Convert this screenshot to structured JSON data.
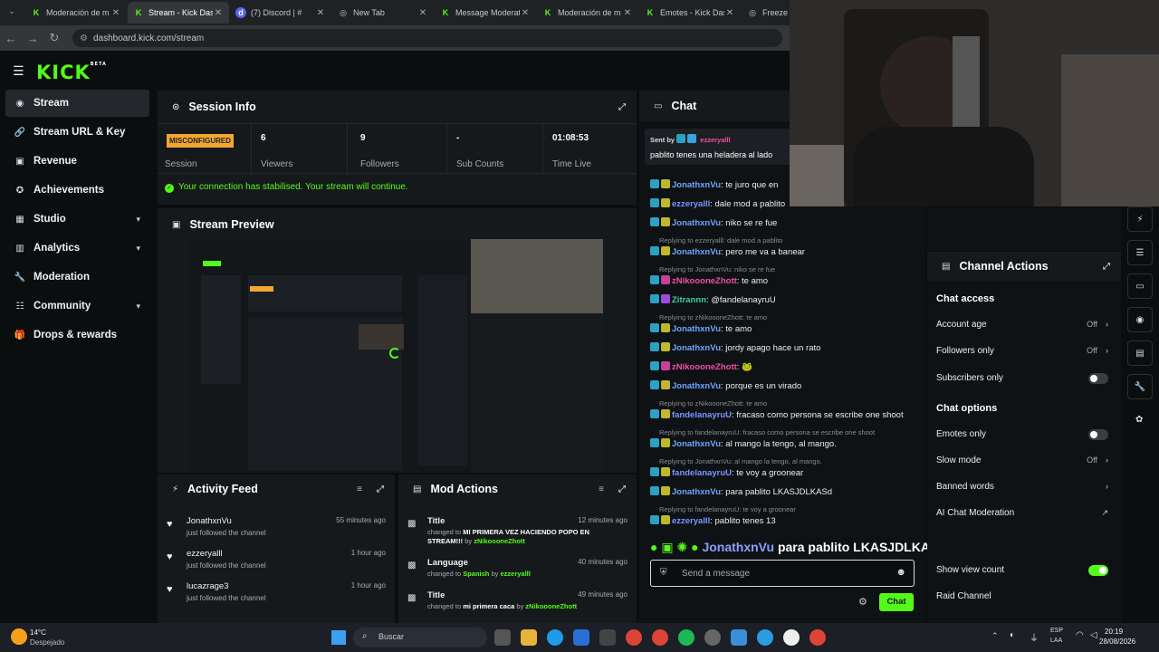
{
  "browser": {
    "tabs": [
      {
        "title": "Moderación de m",
        "favicon": "kick"
      },
      {
        "title": "Stream - Kick Das",
        "favicon": "kick",
        "active": true
      },
      {
        "title": "(7) Discord | #",
        "favicon": "discord"
      },
      {
        "title": "New Tab",
        "favicon": "globe"
      },
      {
        "title": "Message Moderat",
        "favicon": "kick"
      },
      {
        "title": "Moderación de m",
        "favicon": "kick"
      },
      {
        "title": "Emotes - Kick Das",
        "favicon": "kick"
      },
      {
        "title": "Freeze Fr",
        "favicon": "globe"
      }
    ],
    "url": "dashboard.kick.com/stream"
  },
  "logo": "KICK",
  "logo_beta": "BETA",
  "sidebar": {
    "items": [
      {
        "label": "Stream",
        "icon": "broadcast-icon"
      },
      {
        "label": "Stream URL & Key",
        "icon": "link-icon"
      },
      {
        "label": "Revenue",
        "icon": "money-icon"
      },
      {
        "label": "Achievements",
        "icon": "trophy-icon"
      },
      {
        "label": "Studio",
        "icon": "studio-icon"
      },
      {
        "label": "Analytics",
        "icon": "chart-icon"
      },
      {
        "label": "Moderation",
        "icon": "wrench-icon"
      },
      {
        "label": "Community",
        "icon": "people-icon"
      },
      {
        "label": "Drops & rewards",
        "icon": "gift-icon"
      }
    ]
  },
  "session": {
    "title": "Session Info",
    "badge": "MISCONFIGURED",
    "badge_label": "Session",
    "stats": [
      {
        "value": "6",
        "label": "Viewers"
      },
      {
        "value": "9",
        "label": "Followers"
      },
      {
        "value": "-",
        "label": "Sub Counts"
      },
      {
        "value": "01:08:53",
        "label": "Time Live"
      }
    ],
    "notice": "Your connection has stabilised. Your stream will continue."
  },
  "preview": {
    "title": "Stream Preview"
  },
  "activity": {
    "title": "Activity Feed",
    "rows": [
      {
        "name": "JonathxnVu",
        "action": "just followed the channel",
        "time": "55 minutes ago"
      },
      {
        "name": "ezzeryalll",
        "action": "just followed the channel",
        "time": "1 hour ago"
      },
      {
        "name": "lucazrage3",
        "action": "just followed the channel",
        "time": "1 hour ago"
      }
    ]
  },
  "mod_actions": {
    "title": "Mod Actions",
    "rows": [
      {
        "field": "Title",
        "pre": "changed to ",
        "value": "MI PRIMERA VEZ HACIENDO POPO EN STREAM!!!",
        "by": " by ",
        "user": "zNikoooneZhott",
        "time": "12 minutes ago"
      },
      {
        "field": "Language",
        "pre": "changed to ",
        "value": "Spanish",
        "by": " by ",
        "user": "ezzeryalll",
        "time": "40 minutes ago"
      },
      {
        "field": "Title",
        "pre": "changed to ",
        "value": "mi primera caca",
        "by": " by ",
        "user": "zNikoooneZhott",
        "time": "49 minutes ago"
      }
    ]
  },
  "chat": {
    "title": "Chat",
    "pinned_by_label": "Sent by",
    "pinned_user": "ezzeryalll",
    "pinned_text": "pablito tenes una heladera al lado",
    "messages": [
      {
        "reply": "",
        "user": "JonathxnVu",
        "text": ": te juro que en",
        "style": "u1"
      },
      {
        "reply": "",
        "user": "ezzeryalll",
        "text": ": dale mod a pablito",
        "style": "u4"
      },
      {
        "reply": "",
        "user": "JonathxnVu",
        "text": ": niko se re fue",
        "style": "u1"
      },
      {
        "reply": "Replying to ezzeryalll: dale mod a pablito",
        "user": "JonathxnVu",
        "text": ": pero me va a banear",
        "style": "u1"
      },
      {
        "reply": "Replying to JonathxnVu: niko se re fue",
        "user": "zNikoooneZhott",
        "text": ": te amo",
        "style": "u2"
      },
      {
        "reply": "",
        "user": "Zitrannn",
        "text": ": @fandelanayruU",
        "style": "u3"
      },
      {
        "reply": "Replying to zNikoooneZhott: te amo",
        "user": "JonathxnVu",
        "text": ": te amo",
        "style": "u1"
      },
      {
        "reply": "",
        "user": "JonathxnVu",
        "text": ": jordy apago hace un rato",
        "style": "u1"
      },
      {
        "reply": "",
        "user": "zNikoooneZhott",
        "text": ": 🐸",
        "style": "u2"
      },
      {
        "reply": "",
        "user": "JonathxnVu",
        "text": ": porque es un virado",
        "style": "u1"
      },
      {
        "reply": "Replying to zNikoooneZhott: te amo",
        "user": "fandelanayruU",
        "text": ": fracaso como persona se escribe one shoot",
        "style": "u4"
      },
      {
        "reply": "Replying to fandelanayruU: fracaso como persona se escribe one shoot",
        "user": "JonathxnVu",
        "text": ": al mango la tengo, al mango.",
        "style": "u1"
      },
      {
        "reply": "Replying to JonathxnVu: al mango la tengo, al mango.",
        "user": "fandelanayruU",
        "text": ": te voy a groonear",
        "style": "u4"
      },
      {
        "reply": "",
        "user": "JonathxnVu",
        "text": ": para pablito LKASJDLKASd",
        "style": "u1"
      },
      {
        "reply": "Replying to fandelanayruU: te voy a groonear",
        "user": "ezzeryalll",
        "text": ": pablito tenes 13",
        "style": "u4"
      }
    ],
    "overlay_text": "para pablito LKASJDLKASd",
    "overlay_user": "JonathxnVu",
    "input_placeholder": "Send a message",
    "send_label": "Chat"
  },
  "channel_actions": {
    "title": "Channel Actions",
    "access_header": "Chat access",
    "rows_access": [
      {
        "label": "Account age",
        "value": "Off"
      },
      {
        "label": "Followers only",
        "value": "Off"
      },
      {
        "label": "Subscribers only",
        "value": ""
      }
    ],
    "options_header": "Chat options",
    "rows_options": [
      {
        "label": "Emotes only",
        "value": ""
      },
      {
        "label": "Slow mode",
        "value": "Off"
      },
      {
        "label": "Banned words",
        "value": ""
      },
      {
        "label": "AI Chat Moderation",
        "value": ""
      },
      {
        "label": "Show view count",
        "value": ""
      },
      {
        "label": "Raid Channel",
        "value": ""
      }
    ],
    "toggles": {
      "subscribers_only": false,
      "emotes_only": false,
      "show_view_count": true
    }
  },
  "taskbar": {
    "weather_temp": "14°C",
    "weather_desc": "Despejado",
    "search_placeholder": "Buscar",
    "lang": "ESP",
    "region": "LAA",
    "time": "20:19",
    "date": "28/08/2026"
  },
  "colors": {
    "accent": "#53fc18",
    "badge": "#f3a633",
    "panel": "#16191c"
  }
}
